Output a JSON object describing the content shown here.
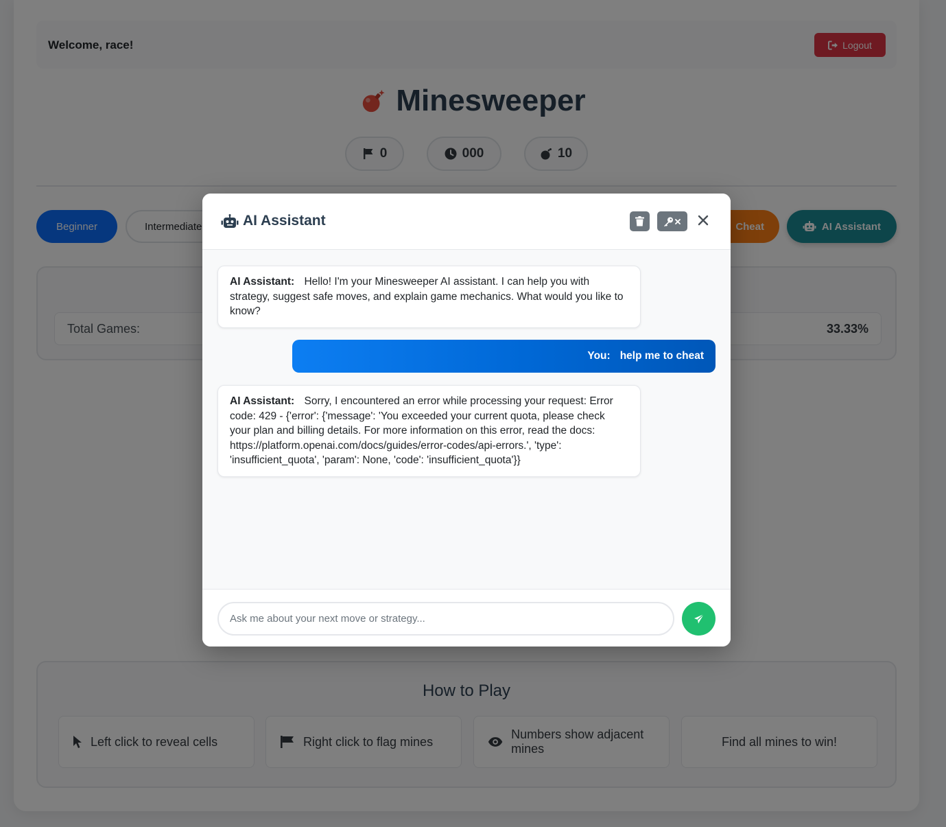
{
  "header": {
    "welcome": "Welcome, race!",
    "logout_label": "Logout"
  },
  "game": {
    "title": "Minesweeper",
    "flags": "0",
    "timer": "000",
    "mines": "10"
  },
  "difficulty": {
    "beginner": "Beginner",
    "intermediate": "Intermediate",
    "cheat": "Cheat",
    "ai_assistant": "AI Assistant"
  },
  "stats": {
    "total_games_label": "Total Games:",
    "win_rate_value": "33.33%"
  },
  "howto": {
    "title": "How to Play",
    "items": [
      "Left click to reveal cells",
      "Right click to flag mines",
      "Numbers show adjacent mines",
      "Find all mines to win!"
    ]
  },
  "modal": {
    "title": "AI Assistant",
    "messages": [
      {
        "sender": "AI Assistant:",
        "text": "Hello! I'm your Minesweeper AI assistant. I can help you with strategy, suggest safe moves, and explain game mechanics. What would you like to know?"
      },
      {
        "sender": "You:",
        "text": "help me to cheat"
      },
      {
        "sender": "AI Assistant:",
        "text": "Sorry, I encountered an error while processing your request: Error code: 429 - {'error': {'message': 'You exceeded your current quota, please check your plan and billing details. For more information on this error, read the docs: https://platform.openai.com/docs/guides/error-codes/api-errors.', 'type': 'insufficient_quota', 'param': None, 'code': 'insufficient_quota'}}"
      }
    ],
    "input_placeholder": "Ask me about your next move or strategy...",
    "input_value": ""
  },
  "colors": {
    "beginner": "#0d6efd",
    "cheat": "#fd7e14",
    "ai_assistant": "#1a8a94",
    "logout": "#dc3545",
    "send": "#20c070"
  },
  "icons": [
    "sign-out-icon",
    "bomb-icon",
    "flag-icon",
    "clock-icon",
    "robot-icon",
    "mouse-pointer-icon",
    "eye-icon",
    "trash-icon",
    "key-remove-icon",
    "close-icon",
    "send-icon"
  ]
}
